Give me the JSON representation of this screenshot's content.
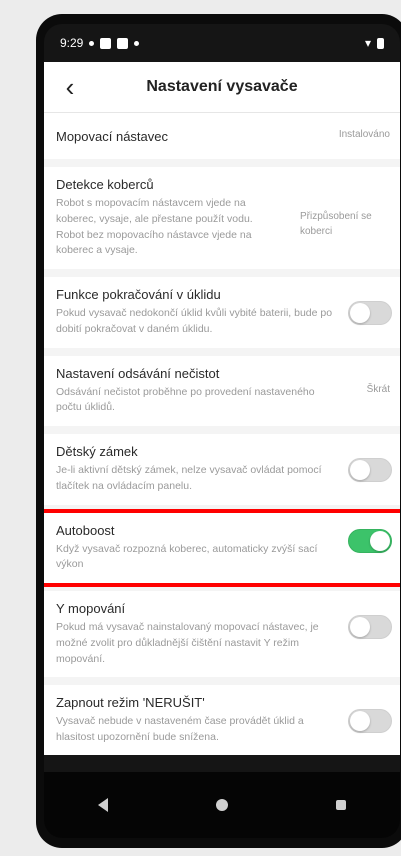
{
  "status_bar": {
    "time": "9:29"
  },
  "header": {
    "title": "Nastavení vysavače",
    "back_icon": "chevron-left-icon"
  },
  "settings": {
    "mopping_attachment": {
      "label": "Mopovací nástavec",
      "value": "Instalováno"
    },
    "carpet_detection": {
      "label": "Detekce koberců",
      "desc": "Robot s mopovacím nástavcem vjede na koberec, vysaje, ale přestane použít vodu. Robot bez mopovacího nástavce vjede na koberec a vysaje.",
      "value": "Přizpůsobení se koberci"
    },
    "continue_cleaning": {
      "label": "Funkce pokračování v úklidu",
      "desc": "Pokud vysavač nedokončí úklid kvůli vybité baterii, bude po dobití pokračovat v daném úklidu.",
      "enabled": false
    },
    "dirt_suction": {
      "label": "Nastavení odsávání nečistot",
      "desc": "Odsávání nečistot proběhne po provedení nastaveného počtu úklidů.",
      "value": "Škrát"
    },
    "child_lock": {
      "label": "Dětský zámek",
      "desc": "Je-li aktivní dětský zámek, nelze vysavač ovládat pomocí tlačítek na ovládacím panelu.",
      "enabled": false
    },
    "autoboost": {
      "label": "Autoboost",
      "desc": "Když vysavač rozpozná koberec, automaticky zvýší sací výkon",
      "enabled": true,
      "highlight_color": "#ff0000"
    },
    "y_mopping": {
      "label": "Y mopování",
      "desc": "Pokud má vysavač nainstalovaný mopovací nástavec, je možné zvolit pro důkladnější čištění nastavit Y režim mopování.",
      "enabled": false
    },
    "do_not_disturb": {
      "label": "Zapnout režim 'NERUŠIT'",
      "desc": "Vysavač nebude v nastaveném čase provádět úklid a hlasitost upozornění bude snížena.",
      "enabled": false
    }
  },
  "colors": {
    "toggle_on": "#3cc36a",
    "toggle_off": "#d9d9d9"
  }
}
